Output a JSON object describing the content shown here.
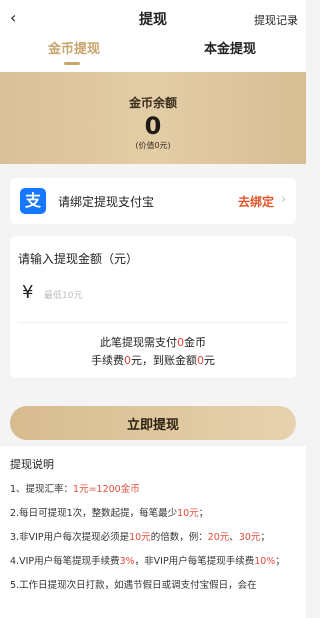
{
  "header": {
    "back_icon": "‹",
    "title": "提现",
    "record_link": "提现记录"
  },
  "tabs": [
    {
      "label": "金币提现",
      "active": true
    },
    {
      "label": "本金提现",
      "active": false
    }
  ],
  "balance": {
    "label": "金币余额",
    "value": "0",
    "sub": "(价值0元)"
  },
  "bind": {
    "icon": "alipay-icon",
    "icon_char": "支",
    "text": "请绑定提现支付宝",
    "action": "去绑定",
    "chevron": "›"
  },
  "amount": {
    "title": "请输入提现金额（元）",
    "currency": "¥",
    "placeholder": "最低10元",
    "pay_prefix": "此笔提现需支付",
    "pay_amount": "0",
    "pay_suffix": "金币",
    "fee_prefix": "手续费",
    "fee_amount": "0",
    "fee_mid": "元，到账金额",
    "arrive_amount": "0",
    "fee_suffix": "元"
  },
  "submit_label": "立即提现",
  "notes": {
    "title": "提现说明",
    "n1_prefix": "1、提现汇率：",
    "n1_red": "1元=1200金币",
    "n2_prefix": "2.每日可提现1次，整数起提，每笔最少",
    "n2_red": "10元",
    "n2_suffix": "；",
    "n3_prefix": "3.非VIP用户每次提现必须是",
    "n3_red1": "10元",
    "n3_mid": "的倍数，例：",
    "n3_red2": "20元",
    "n3_sep": "、",
    "n3_red3": "30元",
    "n3_suffix": "；",
    "n4_prefix": "4.VIP用户每笔提现手续费",
    "n4_red1": "3%",
    "n4_mid": "，非VIP用户每笔提现手续费",
    "n4_red2": "10%",
    "n4_suffix": "；",
    "n5": "5.工作日提现次日打款，如遇节假日或调支付宝假日，会在"
  },
  "colors": {
    "accent_gold": "#c9a46c",
    "alipay_blue": "#1677ff",
    "highlight_red": "#e24a3b"
  }
}
